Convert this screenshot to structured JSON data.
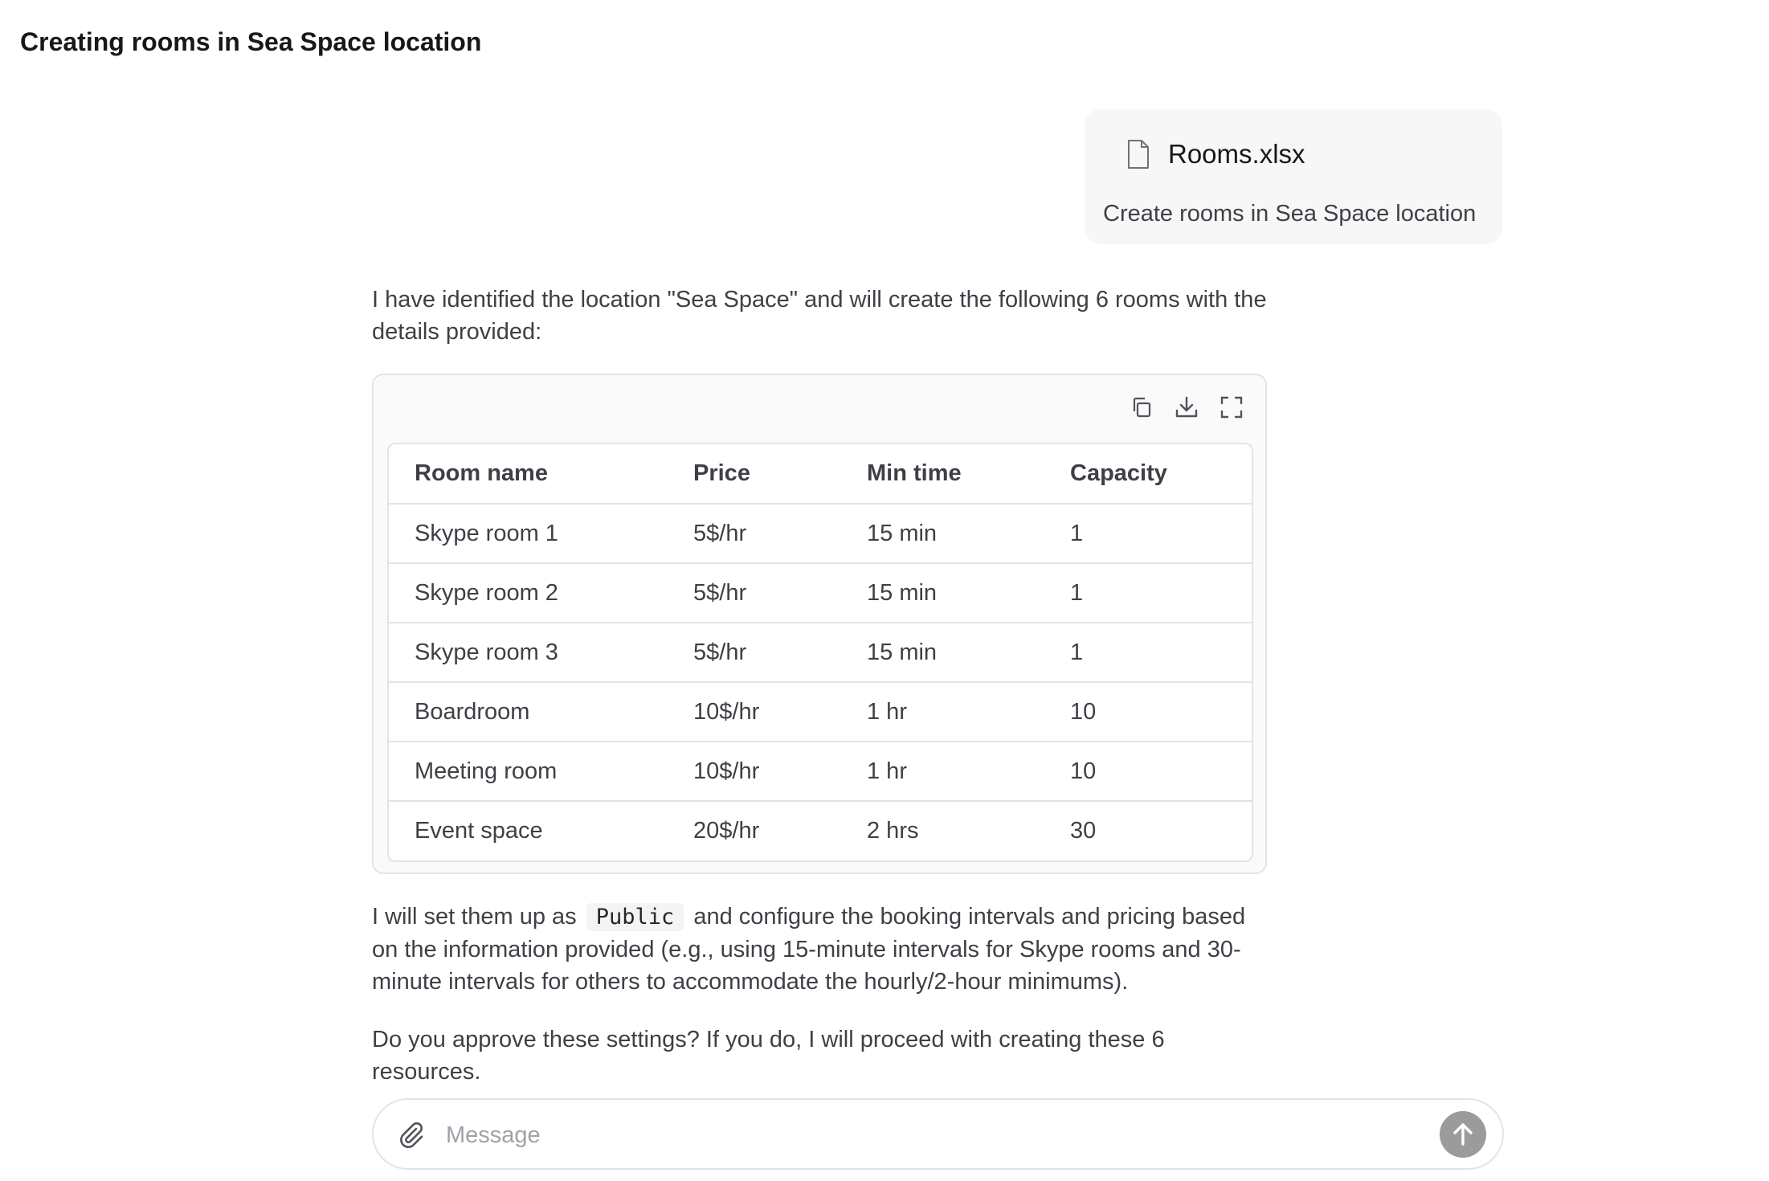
{
  "header": {
    "title": "Creating rooms in Sea Space location"
  },
  "user_message": {
    "attachment": {
      "name": "Rooms.xlsx",
      "icon": "file-icon"
    },
    "text": "Create rooms in Sea Space location"
  },
  "assistant": {
    "intro": "I have identified the location \"Sea Space\" and will create the following 6 rooms with the details provided:",
    "table": {
      "tools": [
        "copy-icon",
        "download-icon",
        "fullscreen-icon"
      ],
      "headers": [
        "Room name",
        "Price",
        "Min time",
        "Capacity"
      ],
      "rows": [
        [
          "Skype room 1",
          "5$/hr",
          "15 min",
          "1"
        ],
        [
          "Skype room 2",
          "5$/hr",
          "15 min",
          "1"
        ],
        [
          "Skype room 3",
          "5$/hr",
          "15 min",
          "1"
        ],
        [
          "Boardroom",
          "10$/hr",
          "1 hr",
          "10"
        ],
        [
          "Meeting room",
          "10$/hr",
          "1 hr",
          "10"
        ],
        [
          "Event space",
          "20$/hr",
          "2 hrs",
          "30"
        ]
      ]
    },
    "setup": {
      "before": "I will set them up as",
      "code": "Public",
      "after": "and configure the booking intervals and pricing based on the information provided (e.g., using 15-minute intervals for Skype rooms and 30-minute intervals for others to accommodate the hourly/2-hour minimums)."
    },
    "question": "Do you approve these settings? If you do, I will proceed with creating these 6 resources."
  },
  "composer": {
    "placeholder": "Message",
    "value": "",
    "attach_icon": "paperclip-icon",
    "send_icon": "arrow-up-icon"
  },
  "colors": {
    "send_button": "#9b9b9b",
    "bubble_bg": "#f7f7f8",
    "border": "#e4e4e7"
  }
}
